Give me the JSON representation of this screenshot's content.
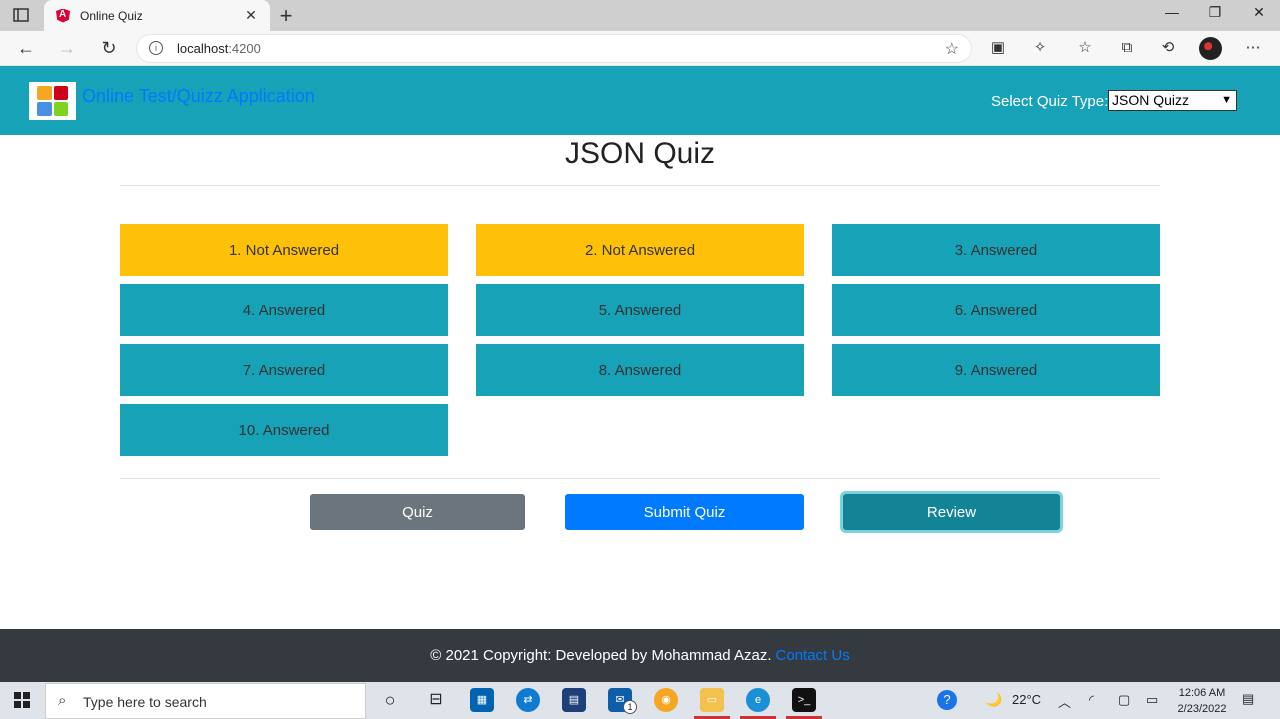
{
  "browser": {
    "tab_title": "Online Quiz",
    "tab_close": "✕",
    "new_tab": "+",
    "url_host": "localhost",
    "url_port": ":4200",
    "minimize": "—",
    "maximize": "❐",
    "close": "✕"
  },
  "header": {
    "brand": "Online Test/Quizz Application",
    "quiz_type_label": "Select Quiz Type:",
    "quiz_type_selected": "JSON Quizz"
  },
  "main": {
    "title": "JSON Quiz",
    "questions": [
      {
        "label": "1. Not Answered",
        "status": "not-answered"
      },
      {
        "label": "2. Not Answered",
        "status": "not-answered"
      },
      {
        "label": "3. Answered",
        "status": "answered"
      },
      {
        "label": "4. Answered",
        "status": "answered"
      },
      {
        "label": "5. Answered",
        "status": "answered"
      },
      {
        "label": "6. Answered",
        "status": "answered"
      },
      {
        "label": "7. Answered",
        "status": "answered"
      },
      {
        "label": "8. Answered",
        "status": "answered"
      },
      {
        "label": "9. Answered",
        "status": "answered"
      },
      {
        "label": "10. Answered",
        "status": "answered"
      }
    ],
    "buttons": {
      "quiz": "Quiz",
      "submit": "Submit Quiz",
      "review": "Review"
    }
  },
  "footer": {
    "copyright": "© 2021 Copyright: Developed by Mohammad Azaz.",
    "contact": "Contact Us"
  },
  "taskbar": {
    "search_placeholder": "Type here to search",
    "weather": "22°C",
    "time": "12:06 AM",
    "date": "2/23/2022",
    "mail_badge": "1"
  },
  "colors": {
    "answered": "#17a2b8",
    "not_answered": "#ffc107",
    "header": "#17a2b8",
    "primary": "#007bff",
    "secondary": "#6c757d",
    "footer": "#343a40"
  }
}
